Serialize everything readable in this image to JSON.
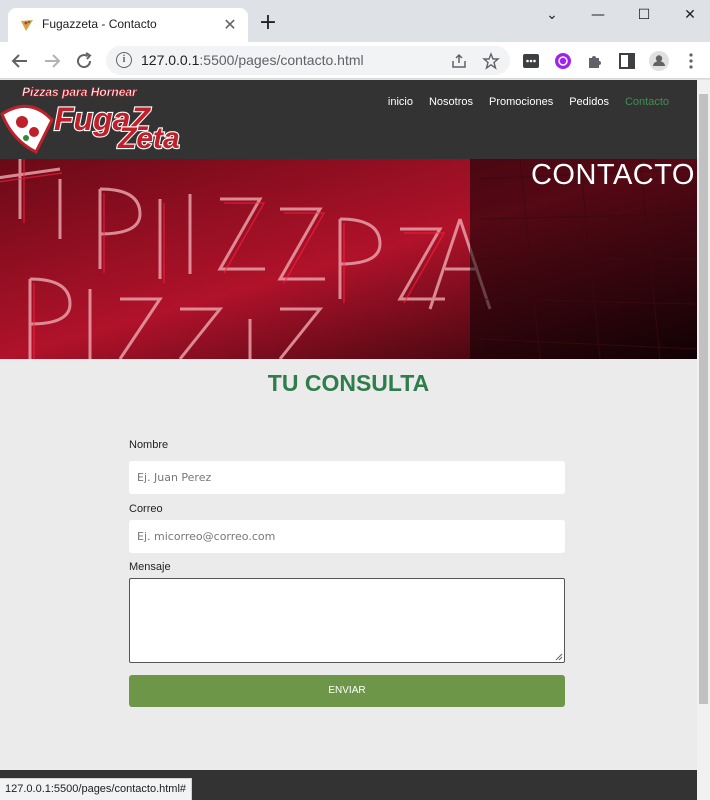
{
  "browser": {
    "tab_title": "Fugazzeta - Contacto",
    "tab_close": "✕",
    "new_tab": "+",
    "url_host": "127.0.0.1",
    "url_rest": ":5500/pages/contacto.html",
    "status_url": "127.0.0.1:5500/pages/contacto.html#",
    "window_minimize": "—",
    "window_maximize": "☐",
    "window_close": "✕",
    "tab_search": "⌄"
  },
  "site": {
    "logo_tagline": "Pizzas para Hornear",
    "logo_name_1": "FugaZ",
    "logo_name_2": "Zeta",
    "nav": [
      {
        "label": "inicio"
      },
      {
        "label": "Nosotros"
      },
      {
        "label": "Promociones"
      },
      {
        "label": "Pedidos"
      },
      {
        "label": "Contacto",
        "active": true
      }
    ],
    "hero_title": "CONTACTO",
    "hero_neon_text": "PIZZA"
  },
  "form": {
    "title": "TU CONSULTA",
    "name_label": "Nombre",
    "name_placeholder": "Ej. Juan Perez",
    "email_label": "Correo",
    "email_placeholder": "Ej. micorreo@correo.com",
    "message_label": "Mensaje",
    "message_value": "",
    "submit_label": "ENVIAR"
  },
  "colors": {
    "accent_green": "#2e7d4a",
    "button_green": "#6e9648",
    "header_dark": "#333333",
    "neon_red": "#d0102a"
  }
}
